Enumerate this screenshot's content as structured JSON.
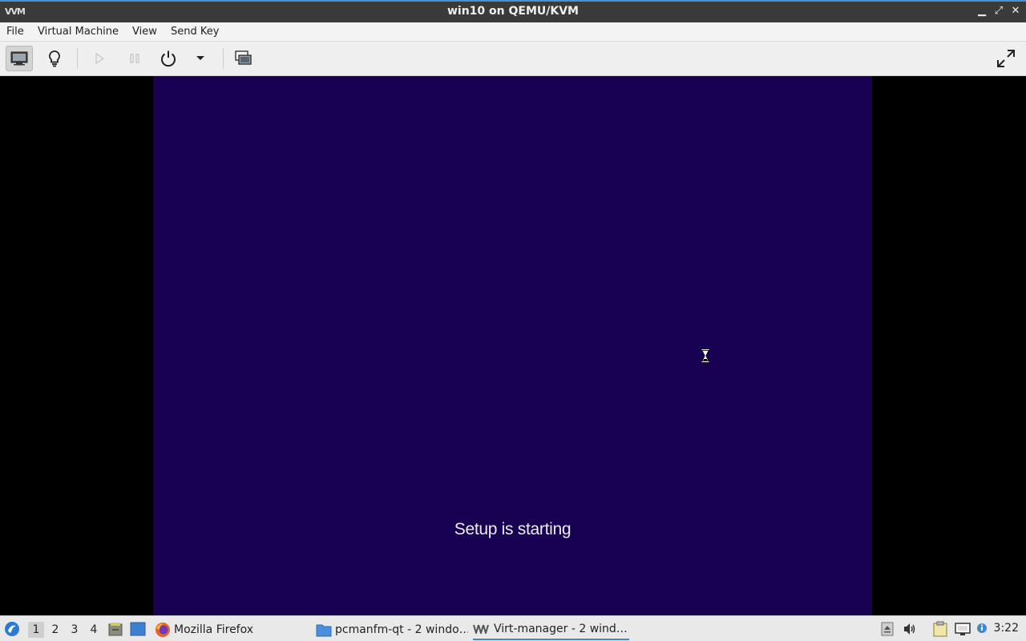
{
  "window": {
    "app_icon": "VVM",
    "title": "win10 on QEMU/KVM",
    "minimize_glyph": "▁",
    "maximize_glyph": "⤢",
    "close_glyph": "✕"
  },
  "menu": {
    "file": "File",
    "virtual_machine": "Virtual Machine",
    "view": "View",
    "send_key": "Send Key"
  },
  "toolbar": {
    "icons": [
      "monitor-icon",
      "lightbulb-icon",
      "play-icon",
      "pause-icon",
      "power-icon",
      "dropdown-arrow-icon",
      "snapshots-icon",
      "fullscreen-icon"
    ]
  },
  "vm_screen": {
    "status_text": "Setup is starting",
    "background_color": "#180052"
  },
  "taskbar": {
    "workspaces": [
      "1",
      "2",
      "3",
      "4"
    ],
    "current_workspace": "1",
    "tasks": [
      {
        "label": "Mozilla Firefox",
        "icon": "firefox-icon"
      },
      {
        "label": "pcmanfm-qt - 2 windo…",
        "icon": "folder-icon"
      },
      {
        "label": "Virt-manager - 2 wind…",
        "icon": "virt-manager-icon"
      }
    ],
    "clock": "3:22"
  },
  "colors": {
    "accent": "#3b8ad8",
    "vm_background": "#180052",
    "titlebar": "#3a3a3a"
  }
}
